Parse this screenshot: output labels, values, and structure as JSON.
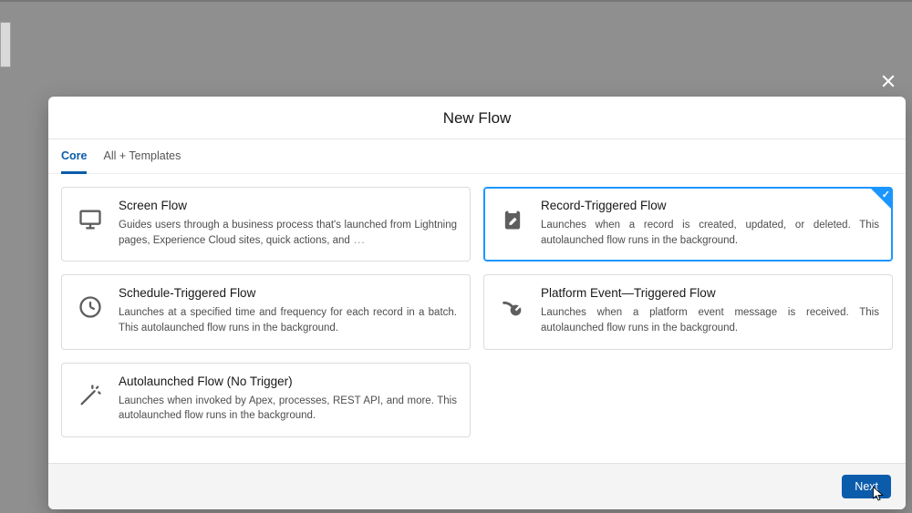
{
  "modal": {
    "title": "New Flow",
    "close_aria": "Close"
  },
  "tabs": [
    {
      "label": "Core",
      "active": true
    },
    {
      "label": "All + Templates",
      "active": false
    }
  ],
  "cards": [
    {
      "id": "screen-flow",
      "title": "Screen Flow",
      "desc": "Guides users through a business process that's launched from Lightning pages, Experience Cloud sites, quick actions, and",
      "truncated": true,
      "icon": "monitor-icon",
      "selected": false
    },
    {
      "id": "record-triggered-flow",
      "title": "Record-Triggered Flow",
      "desc": "Launches when a record is created, updated, or deleted. This autolaunched flow runs in the background.",
      "truncated": false,
      "icon": "clipboard-edit-icon",
      "selected": true
    },
    {
      "id": "schedule-triggered-flow",
      "title": "Schedule-Triggered Flow",
      "desc": "Launches at a specified time and frequency for each record in a batch. This autolaunched flow runs in the background.",
      "truncated": false,
      "icon": "clock-icon",
      "selected": false
    },
    {
      "id": "platform-event-triggered-flow",
      "title": "Platform Event—Triggered Flow",
      "desc": "Launches when a platform event message is received. This autolaunched flow runs in the background.",
      "truncated": false,
      "icon": "broadcast-icon",
      "selected": false
    },
    {
      "id": "autolaunched-flow-no-trigger",
      "title": "Autolaunched Flow (No Trigger)",
      "desc": "Launches when invoked by Apex, processes, REST API, and more. This autolaunched flow runs in the background.",
      "truncated": false,
      "icon": "wand-icon",
      "selected": false
    }
  ],
  "footer": {
    "next_label": "Next"
  },
  "colors": {
    "brand": "#0b5cab",
    "select": "#1b96ff"
  }
}
